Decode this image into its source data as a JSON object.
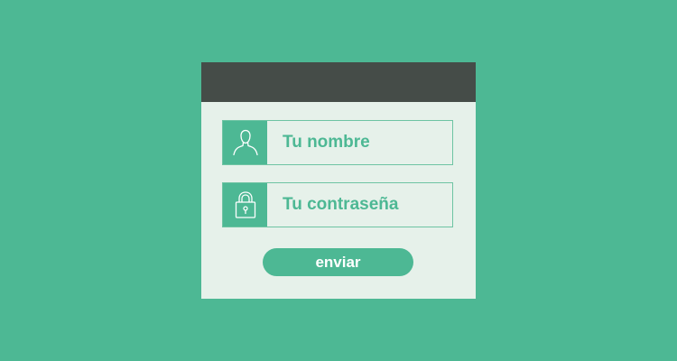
{
  "colors": {
    "background": "#4db894",
    "accent": "#4db894",
    "titlebar": "#454c48",
    "panel": "#e6f1ea",
    "field_border": "#6ec4a3",
    "button_text": "#ffffff"
  },
  "form": {
    "username": {
      "icon": "user-icon",
      "placeholder": "Tu nombre"
    },
    "password": {
      "icon": "lock-icon",
      "placeholder": "Tu contraseña"
    },
    "submit_label": "enviar"
  }
}
